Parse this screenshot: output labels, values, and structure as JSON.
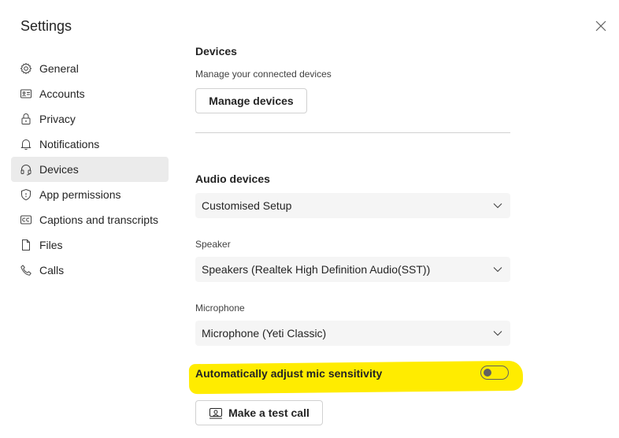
{
  "window": {
    "title": "Settings"
  },
  "sidebar": {
    "items": [
      {
        "label": "General",
        "icon": "gear-icon",
        "active": false
      },
      {
        "label": "Accounts",
        "icon": "accounts-icon",
        "active": false
      },
      {
        "label": "Privacy",
        "icon": "lock-icon",
        "active": false
      },
      {
        "label": "Notifications",
        "icon": "bell-icon",
        "active": false
      },
      {
        "label": "Devices",
        "icon": "headset-icon",
        "active": true
      },
      {
        "label": "App permissions",
        "icon": "shield-icon",
        "active": false
      },
      {
        "label": "Captions and transcripts",
        "icon": "captions-icon",
        "active": false
      },
      {
        "label": "Files",
        "icon": "file-icon",
        "active": false
      },
      {
        "label": "Calls",
        "icon": "phone-icon",
        "active": false
      }
    ]
  },
  "devices": {
    "heading": "Devices",
    "subtitle": "Manage your connected devices",
    "manage_button": "Manage devices"
  },
  "audio": {
    "heading": "Audio devices",
    "setup_value": "Customised Setup",
    "speaker_label": "Speaker",
    "speaker_value": "Speakers (Realtek High Definition Audio(SST))",
    "microphone_label": "Microphone",
    "microphone_value": "Microphone (Yeti Classic)",
    "auto_adjust_label": "Automatically adjust mic sensitivity",
    "auto_adjust_on": false,
    "test_call_button": "Make a test call"
  },
  "colors": {
    "highlight": "#ffec00",
    "active_nav": "#ebebeb",
    "select_bg": "#f5f5f5"
  }
}
